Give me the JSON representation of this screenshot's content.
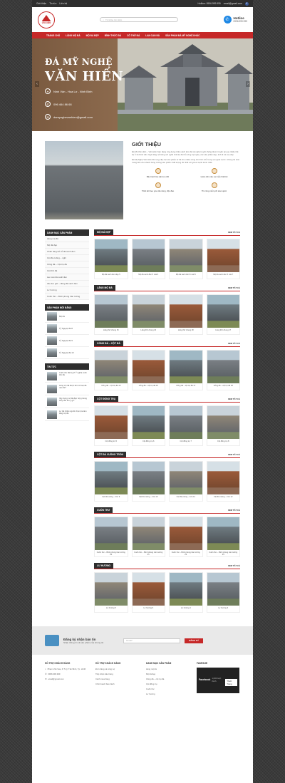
{
  "topbar": {
    "links": [
      "Giới thiệu",
      "Tin tức",
      "Liên hệ"
    ],
    "hotline": "Hotline: 0996.999.999",
    "email": "email@gmail.com",
    "fb_glyph": "f"
  },
  "header": {
    "logo_text": "VĂN HIẾN",
    "search_placeholder": "Từ khóa tìm kiếm",
    "hotline_label": "Hotline",
    "hotline_number": "0996.999.999"
  },
  "nav": [
    "TRANG CHỦ",
    "LĂNG MỘ ĐÁ",
    "MỘ ĐÁ ĐẸP",
    "BÌNH THỨC ĐÁ",
    "CÔ THỜ ĐÁ",
    "LAN CAN ĐÁ",
    "SẢN PHẨM ĐÁ MỸ NGHỆ KHÁC"
  ],
  "banner": {
    "title1": "ĐÁ MỸ NGHỆ",
    "title2": "VĂN HIẾN",
    "address": "Ninh Vân - Hoa Lư - Ninh Bình",
    "phone": "096 464 86 68",
    "email": "damynghevanhien@gmail.com"
  },
  "intro": {
    "heading": "GIỚI THIỆU",
    "p1": "Đá Mỹ Văn Hiến – Văn Hiến hiện đang ứng dụng nhiều cách làm đá mỹ nghệ truyền thống được truyền lại qua nhiều thế hệ ở xã Ninh Vân. Ngôi làng nổi tiếng với nghề chế tác đá thủ công mỹ nghệ, các sản phẩm đẹp, tinh tế và cao cấp.",
    "p2": "Đá Mỹ Nghệ Văn Hiến đã cung cấp các sản phẩm từ đá cho nhiều công trình lớn nhỏ trong và ngoài nước. Chúng tôi luôn mang đến cho khách hàng những sản phẩm chất lượng tốt nhất với giá cả cạnh tranh nhất.",
    "features": [
      "Bảo hành lâu dài trọn đời",
      "Hoàn tiền nếu sai mẫu thiết kế",
      "Thiết kế theo yêu cầu riêng, độc đáo",
      "Thi công miễn phí toàn quốc"
    ]
  },
  "sidebar": {
    "categories_title": "DANH MỤC SẢN PHẨM",
    "categories": [
      "Lăng mộ đá",
      "Mộ đá đẹp",
      "Chân tảng bể cỏ đá xanh đen",
      "Cột đá cuống – nghi",
      "Cống đá – Cột trụ đá",
      "Cột thờ đá",
      "Lan can đá xanh đen",
      "Lầu lưu giữ – đông đá xanh đen",
      "Lư hương",
      "Cuốn thư – Bình phong trán tường"
    ],
    "new_title": "SẢN PHẨM MỚI ĐĂNG",
    "new_items": [
      "Mộ đá",
      "Tỷ Nguyệt đá 8",
      "Tỷ Nguyệt đá 9",
      "Tỷ Nguyệt đá 10"
    ],
    "news_title": "TIN TỨC",
    "news": [
      "Cuốn thư đá là gì? Ý nghĩa cuốn thư đá",
      "Lăng mộ đá được làm từ loại đá nào tốt?",
      "Xây dựng mộ đá đẹp hợp phong thủy cần lưu ý gì?",
      "Lư đá nhiều người chọn lựa làm lăng mộ đá"
    ]
  },
  "sections": [
    {
      "title": "MỘ ĐÁ ĐẸP",
      "all": "XEM TẤT CẢ",
      "items": [
        "Mộ đá xanh đen đẹp 5",
        "Mộ đá xanh đen 5 mái 6",
        "Mộ đá xanh đen 5 mái 5",
        "Mộ đá xanh đen 5 mái 7"
      ]
    },
    {
      "title": "LĂNG MỘ ĐÁ",
      "all": "XEM TẤT CẢ",
      "items": [
        "Lăng thờ chung 15",
        "Lăng thờ chung 16",
        "Lăng thờ chung 18",
        "Lăng thờ chung 17"
      ]
    },
    {
      "title": "CỔNG ĐÁ – CỘT ĐÁ",
      "all": "XEM TẤT CẢ",
      "items": [
        "Cổng đá – cột trụ đá 15",
        "Cổng đá – cột trụ đá 16",
        "Cổng đá – cột trụ đá 17",
        "Cổng đá – cột trụ đá 18"
      ]
    },
    {
      "title": "CỘT ĐỒNG TRỤ",
      "all": "XEM TẤT CẢ",
      "items": [
        "Cột đồng trụ 5",
        "Cột đồng trụ 6",
        "Cột đồng trụ 7",
        "Cột đồng trụ 8"
      ]
    },
    {
      "title": "CỘT ĐÁ VUÔNG TRÒN",
      "all": "XEM TẤT CẢ",
      "items": [
        "Cột đá vuông – tròn 9",
        "Cột đá vuông – tròn 10",
        "Cột đá vuông – tròn 11",
        "Cột đá vuông – tròn 12"
      ]
    },
    {
      "title": "CUỐN THƯ",
      "all": "XEM TẤT CẢ",
      "items": [
        "Cuốn thư – Bình phong trán tường 20",
        "Cuốn thư – Bình phong trán tường 21",
        "Cuốn thư – Bình phong trán tường 22",
        "Cuốn thư – Bình phong trán tường 23"
      ]
    },
    {
      "title": "LƯ HƯƠNG",
      "all": "XEM TẤT CẢ",
      "items": [
        "Lư hương 5",
        "Lư hương 6",
        "Lư hương 4",
        "Lư hương 3"
      ]
    }
  ],
  "newsletter": {
    "title": "Đăng ký nhận bản tin",
    "subtitle": "Nhận thông tin về sản phẩm của chúng tôi",
    "placeholder": "Email*",
    "button": "ĐĂNG KÝ"
  },
  "footer": {
    "col1_title": "HỖ TRỢ KHÁCH HÀNG",
    "col1": [
      "Phạm Văn Sáu, P. 5 Q. Tân Bình, Tp. HCM",
      "0996.999.999",
      "email@gmail.com"
    ],
    "col2_title": "HỖ TRỢ KHÁCH HÀNG",
    "col2": [
      "Đơn hàng và công nợ",
      "Tiếp nhận bảo hàng",
      "Cách mua hàng",
      "Chính sách bảo hành"
    ],
    "col3_title": "DANH MỤC SẢN PHẨM",
    "col3": [
      "Lăng mộ đá",
      "Mộ đá đẹp",
      "Cống đá – cột trụ đá",
      "Cột đồng trụ",
      "Cuốn thư",
      "Lư hương"
    ],
    "col4_title": "FANPAGE",
    "fb_name": "Facebook",
    "fb_sub": "1,000 lượt thích",
    "fb_like": "Thích Trang"
  }
}
